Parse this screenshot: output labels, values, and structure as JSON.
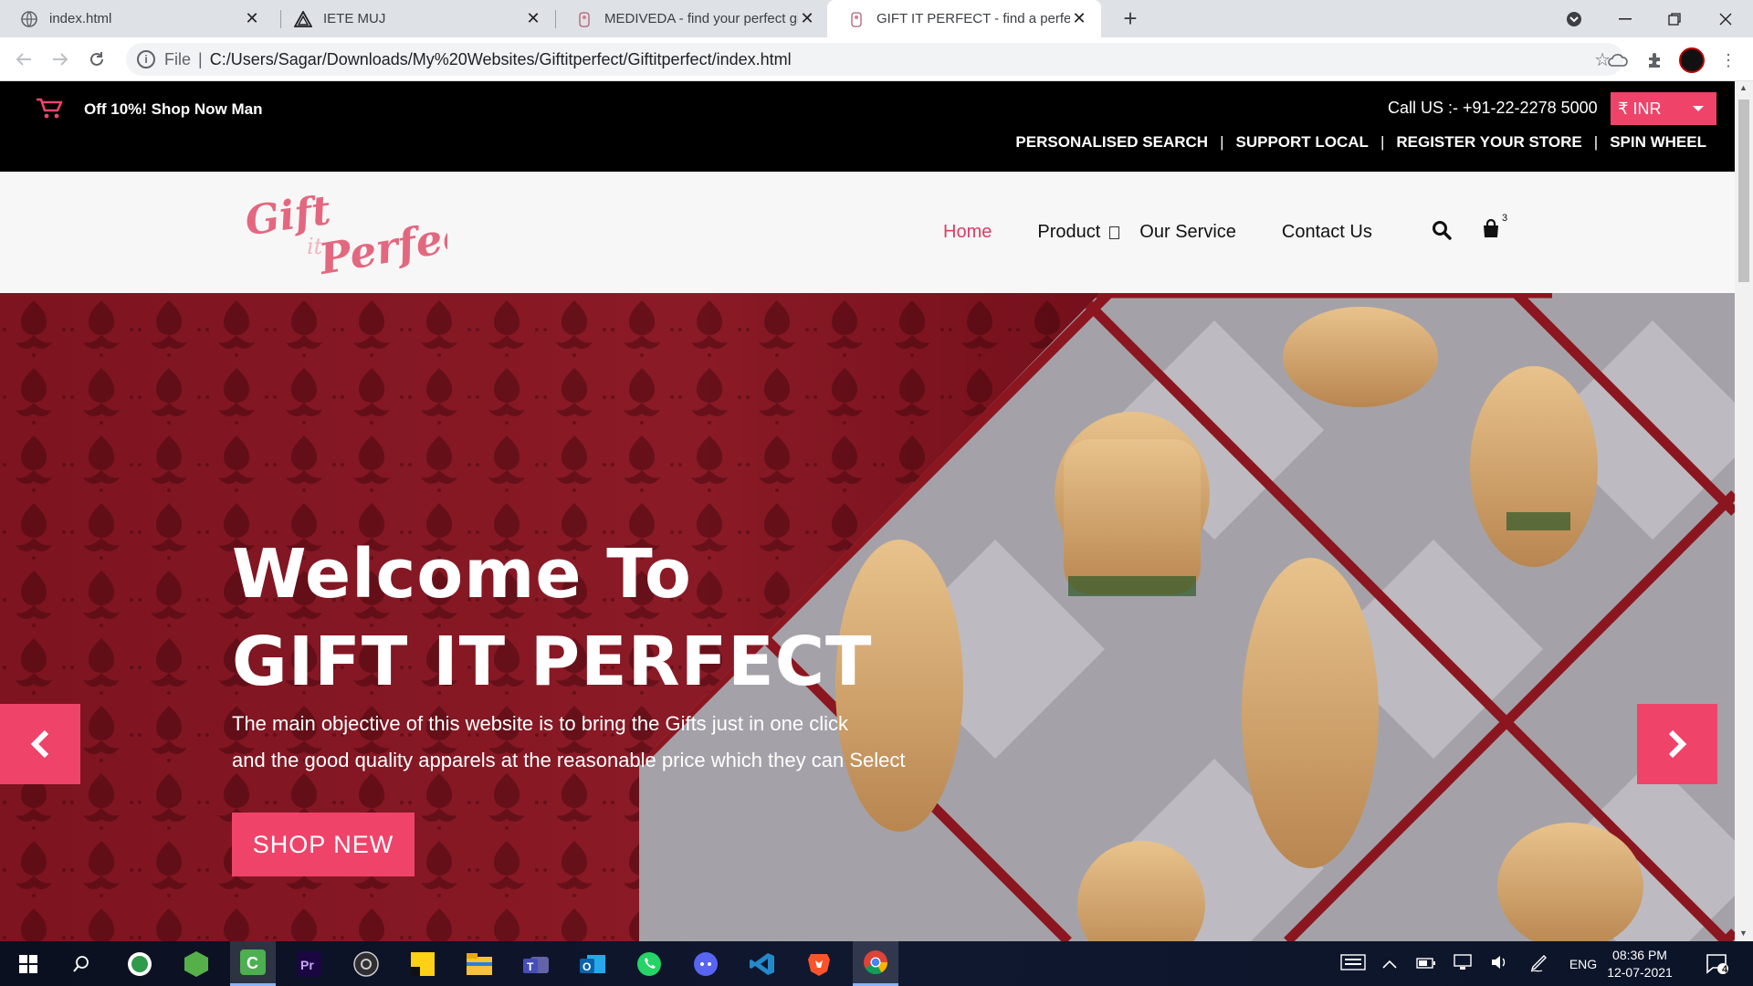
{
  "browser": {
    "tabs": [
      {
        "title": "index.html",
        "active": false
      },
      {
        "title": "IETE MUJ",
        "active": false
      },
      {
        "title": "MEDIVEDA - find your perfect gif",
        "active": false
      },
      {
        "title": "GIFT IT PERFECT - find a perfect g",
        "active": true
      }
    ],
    "address": {
      "scheme_label": "File",
      "url": "C:/Users/Sagar/Downloads/My%20Websites/Giftitperfect/Giftitperfect/index.html"
    }
  },
  "site": {
    "topbar": {
      "promo": "Off 10%! Shop Now Man",
      "call": "Call US :- +91-22-2278 5000",
      "currency": "₹ INR",
      "links": [
        "PERSONALISED SEARCH",
        "SUPPORT LOCAL",
        "REGISTER YOUR STORE",
        "SPIN WHEEL"
      ]
    },
    "nav": {
      "logo_top": "Gift",
      "logo_mid": "it",
      "logo_bottom": "Perfect",
      "links": [
        "Home",
        "Product",
        "Our Service",
        "Contact Us"
      ],
      "cart_count": "3"
    },
    "hero": {
      "title_line1": "Welcome To",
      "title_line2": "GIFT IT PERFECT",
      "desc_line1": "The main objective of this website is to bring the Gifts just in one click",
      "desc_line2": "and the good quality apparels at the reasonable price which they can Select",
      "button": "SHOP NEW"
    }
  },
  "taskbar": {
    "language": "ENG",
    "time": "08:36 PM",
    "date": "12-07-2021",
    "notifications": "4"
  },
  "colors": {
    "accent": "#f0436a",
    "hero_bg": "#7d1420",
    "topbar_bg": "#000000"
  }
}
